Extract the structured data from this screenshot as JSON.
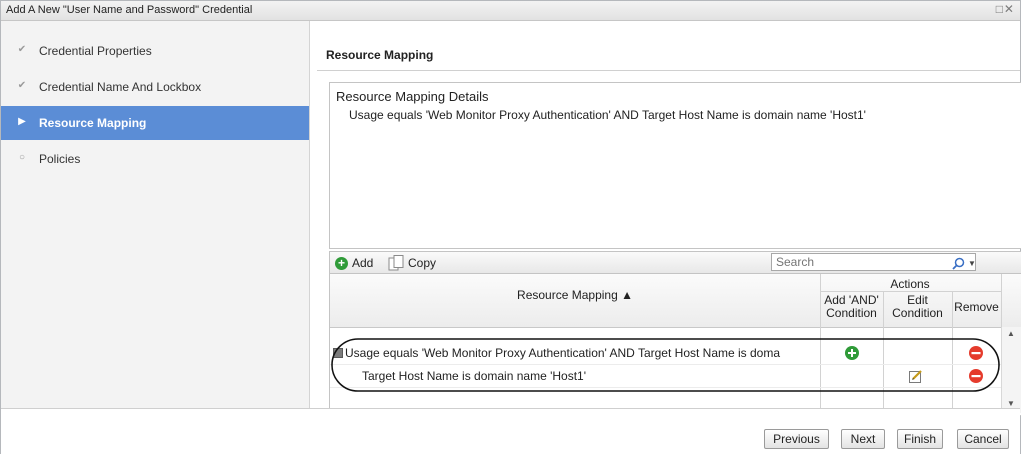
{
  "dialog": {
    "title": "Add A New \"User Name and Password\" Credential",
    "window_controls": "□✕"
  },
  "sidebar": {
    "steps": [
      {
        "label": "Credential Properties",
        "state": "done",
        "icon": "checkmark-icon"
      },
      {
        "label": "Credential Name And Lockbox",
        "state": "done",
        "icon": "checkmark-icon"
      },
      {
        "label": "Resource Mapping",
        "state": "active",
        "icon": "arrow-right-icon"
      },
      {
        "label": "Policies",
        "state": "pending",
        "icon": "circle-icon"
      }
    ]
  },
  "main": {
    "title": "Resource Mapping",
    "details": {
      "title": "Resource Mapping Details",
      "text": "Usage equals 'Web Monitor Proxy Authentication' AND Target Host Name is domain name 'Host1'"
    },
    "toolbar": {
      "add_label": "Add",
      "copy_label": "Copy",
      "search_placeholder": "Search"
    },
    "grid": {
      "columns": {
        "resource_mapping": "Resource Mapping ▲",
        "actions": "Actions",
        "add_and_line1": "Add 'AND'",
        "add_and_line2": "Condition",
        "edit_line1": "Edit",
        "edit_line2": "Condition",
        "remove": "Remove"
      },
      "rows": [
        {
          "text": "Usage equals 'Web Monitor Proxy Authentication' AND Target Host Name is doma",
          "has_add": true,
          "has_edit": false,
          "has_remove": true
        },
        {
          "text": "Target Host Name is domain name 'Host1'",
          "has_add": false,
          "has_edit": true,
          "has_remove": true
        }
      ]
    }
  },
  "footer": {
    "previous": "Previous",
    "next": "Next",
    "finish": "Finish",
    "cancel": "Cancel"
  },
  "colors": {
    "active_step": "#5b8dd6",
    "add_green": "#2f9b38",
    "remove_red": "#e53b2c"
  }
}
